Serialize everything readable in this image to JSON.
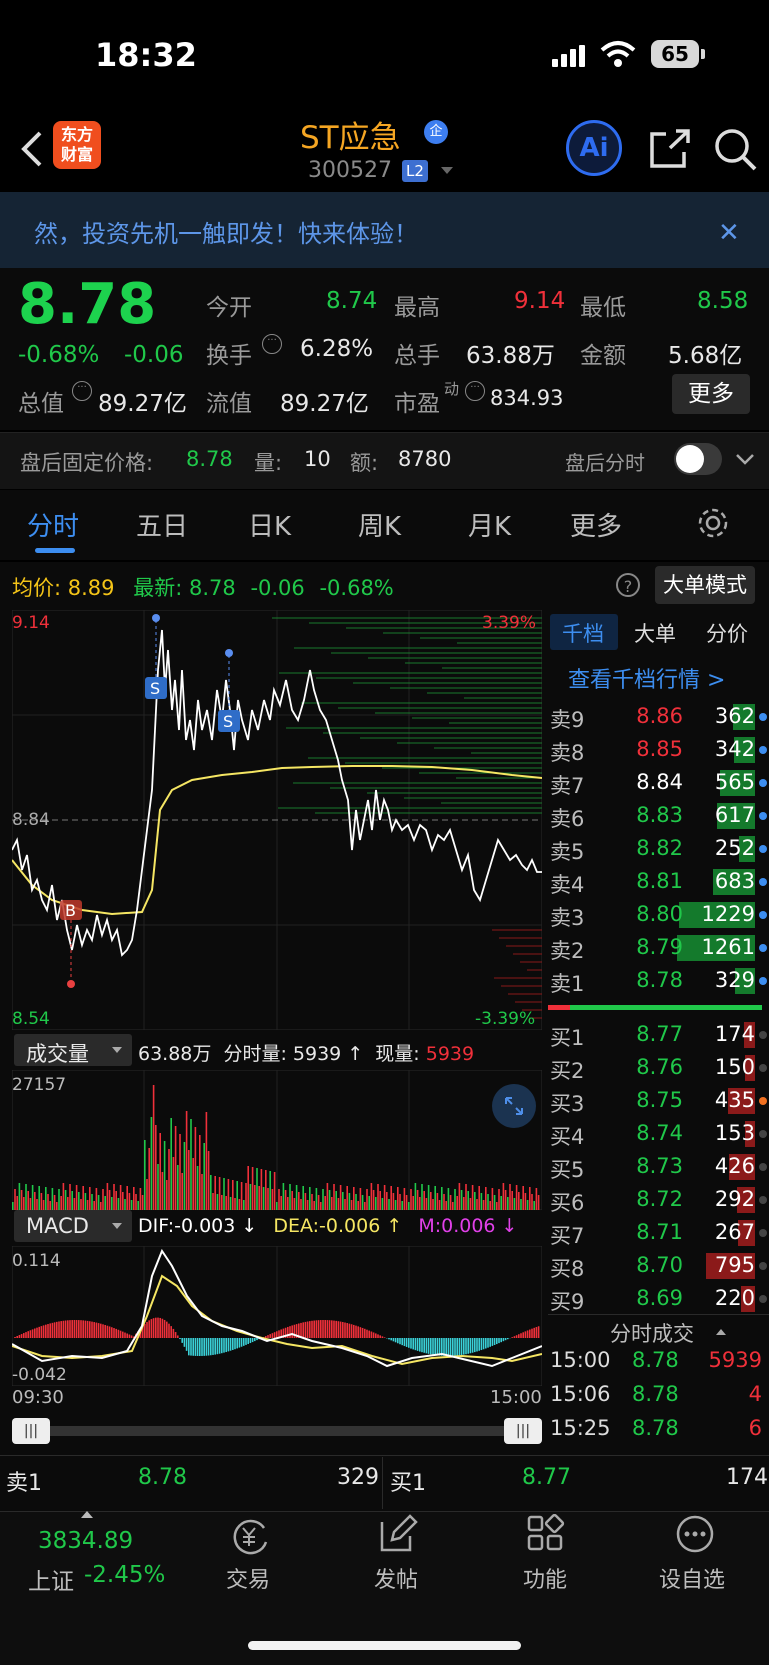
{
  "status": {
    "time": "18:32",
    "battery": "65"
  },
  "header": {
    "logo_text_1": "东方",
    "logo_text_2": "财富",
    "stock_name": "ST应急",
    "qi_badge": "企",
    "stock_code": "300527",
    "level_badge": "L2",
    "ai_label": "Ai",
    "icons": [
      "back-arrow-icon",
      "share-icon",
      "search-icon"
    ]
  },
  "banner": {
    "text": "然，投资先机一触即发！快来体验！",
    "close": "✕"
  },
  "quote": {
    "price": "8.78",
    "change_pct": "-0.68%",
    "change": "-0.06",
    "open_label": "今开",
    "open": "8.74",
    "high_label": "最高",
    "high": "9.14",
    "low_label": "最低",
    "low": "8.58",
    "turnover_label": "换手",
    "turnover": "6.28%",
    "volume_label": "总手",
    "volume": "63.88万",
    "amount_label": "金额",
    "amount": "5.68亿",
    "mktcap_label": "总值",
    "mktcap": "89.27亿",
    "float_label": "流值",
    "float": "89.27亿",
    "pe_label": "市盈",
    "pe_sup": "动",
    "pe": "834.93",
    "more_label": "更多"
  },
  "after_hours": {
    "label": "盘后固定价格:",
    "price": "8.78",
    "vol_label": "量:",
    "vol": "10",
    "amt_label": "额:",
    "amt": "8780",
    "toggle_label": "盘后分时"
  },
  "tabs": [
    "分时",
    "五日",
    "日K",
    "周K",
    "月K",
    "更多"
  ],
  "chart_header": {
    "avg_label": "均价:",
    "avg": "8.89",
    "latest_label": "最新:",
    "latest": "8.78",
    "chg": "-0.06",
    "chg_pct": "-0.68%",
    "big_order_btn": "大单模式"
  },
  "chart_data": {
    "type": "line",
    "price_axis": {
      "max": "9.14",
      "mid": "8.84",
      "min": "8.54",
      "max_pct": "3.39%",
      "min_pct": "-3.39%"
    },
    "markers": [
      "B",
      "S",
      "S"
    ],
    "volume": {
      "label": "成交量",
      "total": "63.88万",
      "minute_vol_label": "分时量:",
      "minute_vol": "5939",
      "arrow": "↑",
      "now_label": "现量:",
      "now": "5939",
      "y_max": "27157"
    },
    "macd": {
      "label": "MACD",
      "dif": "DIF:-0.003 ↓",
      "dea": "DEA:-0.006 ↑",
      "m": "M:0.006 ↓",
      "y_max": "0.114",
      "y_min": "-0.042"
    },
    "time_start": "09:30",
    "time_end": "15:00"
  },
  "orderbook": {
    "tabs": [
      "千档",
      "大单",
      "分价"
    ],
    "link": "查看千档行情 >",
    "asks": [
      {
        "name": "卖9",
        "price": "8.86",
        "qty": "362"
      },
      {
        "name": "卖8",
        "price": "8.85",
        "qty": "342"
      },
      {
        "name": "卖7",
        "price": "8.84",
        "qty": "565"
      },
      {
        "name": "卖6",
        "price": "8.83",
        "qty": "617"
      },
      {
        "name": "卖5",
        "price": "8.82",
        "qty": "252"
      },
      {
        "name": "卖4",
        "price": "8.81",
        "qty": "683"
      },
      {
        "name": "卖3",
        "price": "8.80",
        "qty": "1229"
      },
      {
        "name": "卖2",
        "price": "8.79",
        "qty": "1261"
      },
      {
        "name": "卖1",
        "price": "8.78",
        "qty": "329"
      }
    ],
    "bids": [
      {
        "name": "买1",
        "price": "8.77",
        "qty": "174"
      },
      {
        "name": "买2",
        "price": "8.76",
        "qty": "150"
      },
      {
        "name": "买3",
        "price": "8.75",
        "qty": "435"
      },
      {
        "name": "买4",
        "price": "8.74",
        "qty": "153"
      },
      {
        "name": "买5",
        "price": "8.73",
        "qty": "426"
      },
      {
        "name": "买6",
        "price": "8.72",
        "qty": "292"
      },
      {
        "name": "买7",
        "price": "8.71",
        "qty": "267"
      },
      {
        "name": "买8",
        "price": "8.70",
        "qty": "795"
      },
      {
        "name": "买9",
        "price": "8.69",
        "qty": "220"
      }
    ],
    "ticks_title": "分时成交",
    "ticks": [
      {
        "time": "15:00",
        "price": "8.78",
        "vol": "5939"
      },
      {
        "time": "15:06",
        "price": "8.78",
        "vol": "4"
      },
      {
        "time": "15:25",
        "price": "8.78",
        "vol": "6"
      }
    ]
  },
  "bottom_bar": {
    "sell_label": "卖1",
    "sell_price": "8.78",
    "sell_qty": "329",
    "buy_label": "买1",
    "buy_price": "8.77",
    "buy_qty": "174"
  },
  "nav": {
    "index_value": "3834.89",
    "index_name": "上证",
    "index_chg": "-2.45%",
    "items": [
      "交易",
      "发帖",
      "功能",
      "设自选"
    ]
  }
}
